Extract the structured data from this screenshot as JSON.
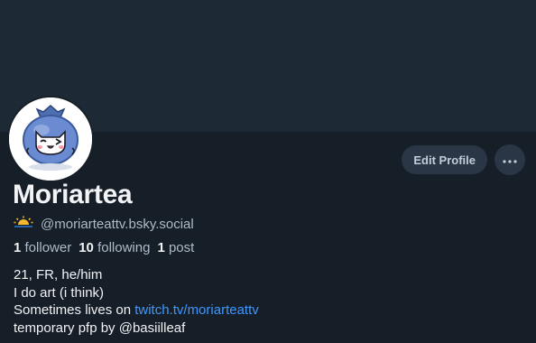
{
  "profile": {
    "display_name": "Moriartea",
    "handle": "@moriarteattv.bsky.social",
    "handle_icon": "sun-icon",
    "stats": {
      "followers_count": "1",
      "followers_label": "follower",
      "following_count": "10",
      "following_label": "following",
      "posts_count": "1",
      "posts_label": "post"
    },
    "bio": {
      "line1": "21, FR, he/him",
      "line2": "I do art (i think)",
      "line3_prefix": "Sometimes lives on ",
      "line3_link": "twitch.tv/moriarteattv",
      "line4": "temporary pfp by @basiilleaf"
    }
  },
  "actions": {
    "edit_label": "Edit Profile",
    "more_icon": "ellipsis-icon"
  },
  "colors": {
    "banner": "#1e2936",
    "background": "#161e27",
    "link": "#3f97ff",
    "button": "#2a3645"
  }
}
